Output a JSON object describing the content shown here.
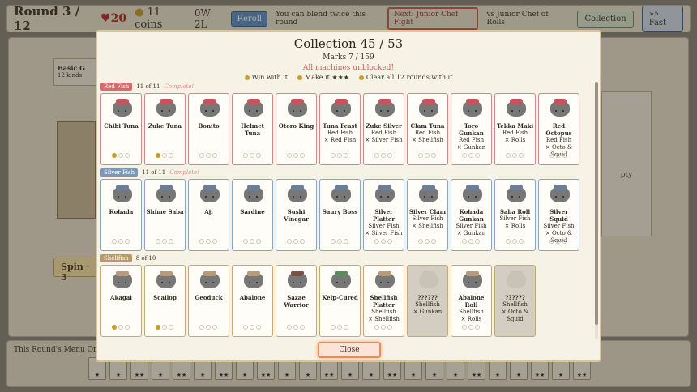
{
  "hud": {
    "round": "Round 3 / 12",
    "hearts": "20",
    "coins": "11 coins",
    "wl": "0W 2L",
    "reroll": "Reroll",
    "hint": "You can blend twice this round",
    "next": "Next: Junior Chef Fight",
    "vs": "vs Junior Chef of Rolls",
    "collection_btn": "Collection",
    "fast_btn": "»» Fast"
  },
  "background": {
    "basic_label": "Basic G",
    "basic_sub": "12 kinds",
    "spin_label": "Spin · 3",
    "right_label": "pty",
    "menu_label": "This Round's Menu",
    "menu_sub": "Only"
  },
  "menu_tiles": [
    "★",
    "★",
    "★★",
    "★",
    "★★",
    "★",
    "★★",
    "★",
    "★★",
    "★",
    "★",
    "★★",
    "★",
    "★",
    "★★",
    "★",
    "★",
    "★",
    "★★",
    "★",
    "★",
    "★★",
    "★",
    "★★"
  ],
  "modal": {
    "title": "Collection  45 / 53",
    "marks": "Marks 7 / 159",
    "unblocked": "All machines unblocked!",
    "legend": [
      "Win with it",
      "Make it ★★★",
      "Clear all 12 rounds with it"
    ],
    "close": "Close"
  },
  "sections": [
    {
      "badge": "Red Fish",
      "count": "11 of 11",
      "status": "Complete!",
      "color": "#d96a6a",
      "cards": [
        {
          "name": "Chibi Tuna",
          "req": "",
          "stats": "win1"
        },
        {
          "name": "Zuke Tuna",
          "req": "",
          "stats": "win1"
        },
        {
          "name": "Bonito",
          "req": "",
          "stats": "empty"
        },
        {
          "name": "Helmet Tuna",
          "req": "",
          "stats": "empty"
        },
        {
          "name": "Otoro King",
          "req": "",
          "stats": "empty"
        },
        {
          "name": "Tuna Feast",
          "req": "Red Fish\n× Red Fish",
          "stats": "empty"
        },
        {
          "name": "Zuke Silver",
          "req": "Red Fish\n× Silver Fish",
          "stats": "empty"
        },
        {
          "name": "Clam Tuna",
          "req": "Red Fish\n× Shellfish",
          "stats": "empty"
        },
        {
          "name": "Toro Gunkan",
          "req": "Red Fish\n× Gunkan",
          "stats": "empty"
        },
        {
          "name": "Tekka Maki",
          "req": "Red Fish\n× Rolls",
          "stats": "empty"
        },
        {
          "name": "Red Octopus",
          "req": "Red Fish\n× Octo &\nSquid",
          "stats": "empty"
        }
      ]
    },
    {
      "badge": "Silver Fish",
      "count": "11 of 11",
      "status": "Complete!",
      "color": "#7d97b8",
      "cards": [
        {
          "name": "Kohada",
          "req": "",
          "stats": "empty"
        },
        {
          "name": "Shime Saba",
          "req": "",
          "stats": "empty"
        },
        {
          "name": "Aji",
          "req": "",
          "stats": "empty"
        },
        {
          "name": "Sardine",
          "req": "",
          "stats": "empty"
        },
        {
          "name": "Sushi Vinegar",
          "req": "",
          "stats": "empty"
        },
        {
          "name": "Saury Boss",
          "req": "",
          "stats": "empty"
        },
        {
          "name": "Silver Platter",
          "req": "Silver Fish\n× Silver Fish",
          "stats": "empty"
        },
        {
          "name": "Silver Clam",
          "req": "Silver Fish\n× Shellfish",
          "stats": "empty"
        },
        {
          "name": "Kohada Gunkan",
          "req": "Silver Fish\n× Gunkan",
          "stats": "empty"
        },
        {
          "name": "Saba Roll",
          "req": "Silver Fish\n× Rolls",
          "stats": "empty"
        },
        {
          "name": "Silver Squid",
          "req": "Silver Fish\n× Octo &\nSquid",
          "stats": "empty"
        }
      ]
    },
    {
      "badge": "Shellfish",
      "count": "8 of 10",
      "status": "",
      "color": "#b8996c",
      "cards": [
        {
          "name": "Akagai",
          "req": "",
          "stats": "win1"
        },
        {
          "name": "Scallop",
          "req": "",
          "stats": "win1"
        },
        {
          "name": "Geoduck",
          "req": "",
          "stats": "empty"
        },
        {
          "name": "Abalone",
          "req": "",
          "stats": "empty"
        },
        {
          "name": "Sazae Warrior",
          "req": "",
          "stats": "empty"
        },
        {
          "name": "Kelp-Cured",
          "req": "",
          "stats": "empty"
        },
        {
          "name": "Shellfish Platter",
          "req": "Shellfish\n× Shellfish",
          "stats": "empty"
        },
        {
          "name": "??????",
          "req": "Shellfish\n× Gunkan",
          "stats": "locked"
        },
        {
          "name": "Abalone Roll",
          "req": "Shellfish\n× Rolls",
          "stats": "empty"
        },
        {
          "name": "??????",
          "req": "Shellfish\n× Octo &\nSquid",
          "stats": "locked"
        }
      ]
    }
  ]
}
